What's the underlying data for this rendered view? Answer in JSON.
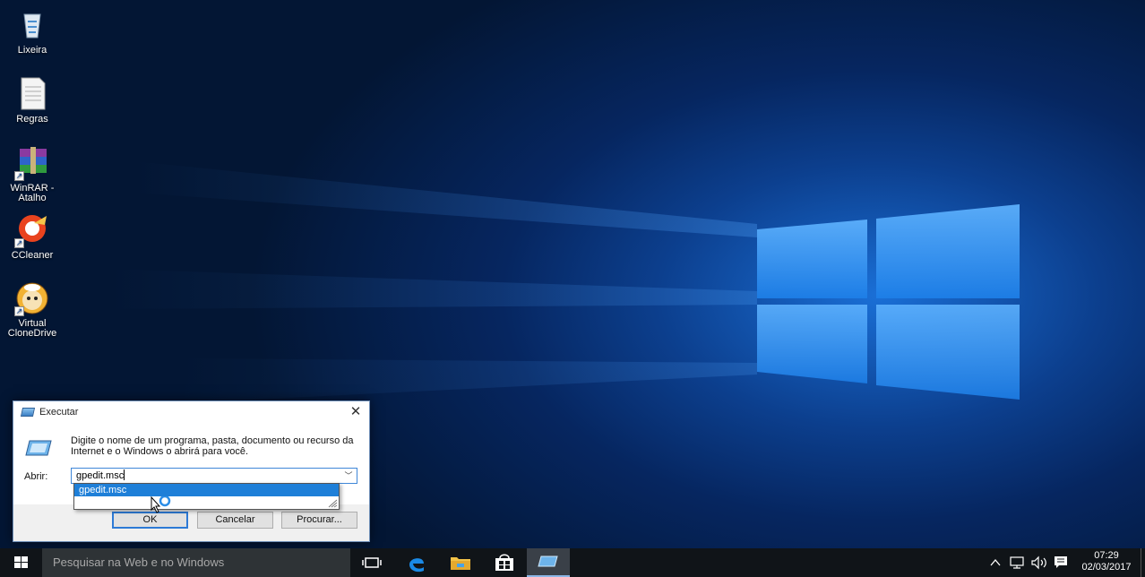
{
  "desktop": {
    "icons": [
      {
        "label": "Lixeira",
        "icon": "recycle-bin-icon"
      },
      {
        "label": "Regras",
        "icon": "text-file-icon"
      },
      {
        "label": "WinRAR - Atalho",
        "icon": "winrar-icon"
      },
      {
        "label": "CCleaner",
        "icon": "ccleaner-icon"
      },
      {
        "label": "Virtual CloneDrive",
        "icon": "virtual-clonedrive-icon"
      }
    ]
  },
  "run_dialog": {
    "title": "Executar",
    "description": "Digite o nome de um programa, pasta, documento ou recurso da Internet e o Windows o abrirá para você.",
    "open_label": "Abrir:",
    "open_value": "gpedit.msc",
    "autocomplete": [
      "gpedit.msc"
    ],
    "ok_label": "OK",
    "cancel_label": "Cancelar",
    "browse_label": "Procurar..."
  },
  "taskbar": {
    "search_placeholder": "Pesquisar na Web e no Windows",
    "apps": [
      "task-view",
      "edge",
      "file-explorer",
      "store",
      "run"
    ],
    "time": "07:29",
    "date": "02/03/2017"
  },
  "colors": {
    "accent": "#1e7fd8",
    "taskbar": "#101418",
    "wallpaper_glow": "#1a6fd6"
  }
}
